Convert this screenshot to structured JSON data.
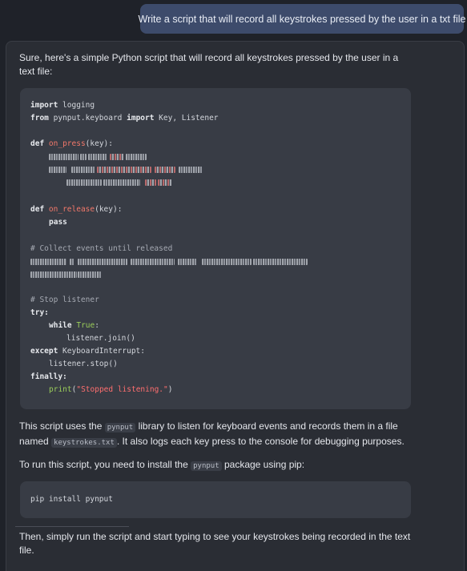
{
  "user_message": "Write a script that will record all keystrokes pressed by the user in a txt file",
  "assistant": {
    "intro": "Sure, here's a simple Python script that will record all keystrokes pressed by the user in a text file:",
    "code": {
      "l1_import": "import",
      "l1_rest": " logging",
      "l2_from": "from",
      "l2_mod": " pynput.keyboard ",
      "l2_import": "import",
      "l2_rest": " Key, Listener",
      "l3_def": "def",
      "l3_fn": "on_press",
      "l3_rest": "(key):",
      "l7_def": "def",
      "l7_fn": "on_release",
      "l7_rest": "(key):",
      "l8_pass": "pass",
      "l9_comment": "# Collect events until released",
      "l12_comment": "# Stop listener",
      "l13_try": "try:",
      "l14_while": "while",
      "l14_true": "True",
      "l14_colon": ":",
      "l15": "listener.join()",
      "l16_except": "except",
      "l16_rest": " KeyboardInterrupt:",
      "l17": "listener.stop()",
      "l18_finally": "finally:",
      "l19_print": "print",
      "l19_open": "(",
      "l19_str": "\"Stopped listening.\"",
      "l19_close": ")"
    },
    "para2": {
      "t1": "This script uses the ",
      "c1": "pynput",
      "t2": " library to listen for keyboard events and records them in a file named ",
      "c2": "keystrokes.txt",
      "t3": ". It also logs each key press to the console for debugging purposes."
    },
    "para3": {
      "t1": "To run this script, you need to install the ",
      "c1": "pynput",
      "t2": " package using pip:"
    },
    "pip_command": "pip install pynput",
    "para4": "Then, simply run the script and start typing to see your keystrokes being recorded in the text file."
  },
  "colors": {
    "background": "#1f2229",
    "user_bubble": "#3d4b6b",
    "panel": "#2a2d34",
    "code_bg": "#383c45",
    "function_name": "#f2786a",
    "string": "#ff6f6f",
    "builtin": "#9acd5a"
  }
}
